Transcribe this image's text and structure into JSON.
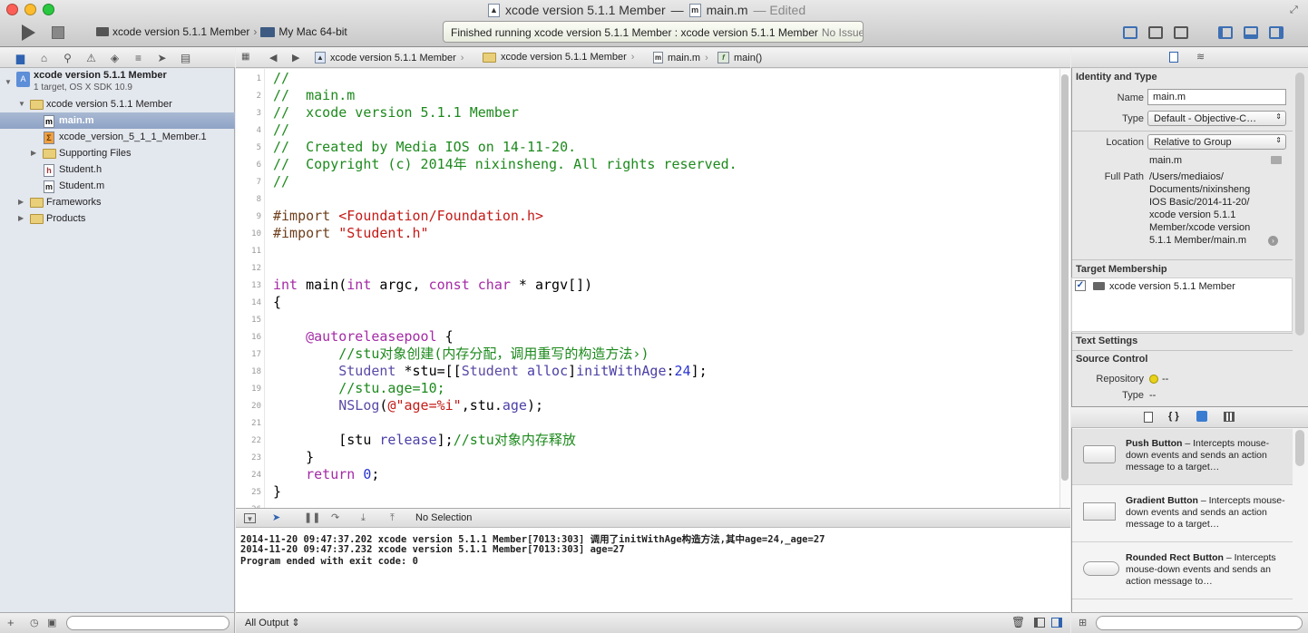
{
  "window": {
    "title_project": "xcode version 5.1.1 Member",
    "title_sep": "—",
    "title_file": "main.m",
    "title_edited": "— Edited"
  },
  "toolbar": {
    "scheme": "xcode version 5.1.1 Member",
    "destination": "My Mac 64-bit",
    "activity": "Finished running xcode version 5.1.1 Member : xcode version 5.1.1 Member",
    "issues": "No Issues"
  },
  "navigator": {
    "project_name": "xcode version 5.1.1 Member",
    "project_sub": "1 target, OS X SDK 10.9",
    "items": [
      {
        "label": "xcode version 5.1.1 Member"
      },
      {
        "label": "main.m"
      },
      {
        "label": "xcode_version_5_1_1_Member.1"
      },
      {
        "label": "Supporting Files"
      },
      {
        "label": "Student.h"
      },
      {
        "label": "Student.m"
      },
      {
        "label": "Frameworks"
      },
      {
        "label": "Products"
      }
    ]
  },
  "jumpbar": {
    "crumb1": "xcode version 5.1.1 Member",
    "crumb2": "xcode version 5.1.1 Member",
    "crumb3": "main.m",
    "crumb4": "main()"
  },
  "editor": {
    "lines": [
      "//",
      "//  main.m",
      "//  xcode version 5.1.1 Member",
      "//",
      "//  Created by Media IOS on 14-11-20.",
      "//  Copyright (c) 2014年 nixinsheng. All rights reserved.",
      "//",
      "",
      "#import <Foundation/Foundation.h>",
      "#import \"Student.h\"",
      "",
      "",
      "int main(int argc, const char * argv[])",
      "{",
      "",
      "    @autoreleasepool {",
      "        //stu对象创建(内存分配，调用重写的构造方法›)",
      "        Student *stu=[[Student alloc]initWithAge:24];",
      "        //stu.age=10;",
      "        NSLog(@\"age=%i\",stu.age);",
      "",
      "        [stu release];//stu对象内存释放",
      "    }",
      "    return 0;",
      "}",
      ""
    ]
  },
  "debug": {
    "selection": "No Selection",
    "console": [
      "2014-11-20 09:47:37.202 xcode version 5.1.1 Member[7013:303] 调用了initWithAge构造方法,其中age=24,_age=27",
      "2014-11-20 09:47:37.232 xcode version 5.1.1 Member[7013:303] age=27",
      "Program ended with exit code: 0"
    ],
    "output_filter": "All Output"
  },
  "inspector": {
    "identity_header": "Identity and Type",
    "name_label": "Name",
    "name_value": "main.m",
    "type_label": "Type",
    "type_value": "Default - Objective-C…",
    "location_label": "Location",
    "location_value": "Relative to Group",
    "location_file": "main.m",
    "fullpath_label": "Full Path",
    "fullpath_lines": [
      "/Users/mediaios/",
      "Documents/nixinsheng",
      "IOS Basic/2014-11-20/",
      "xcode version 5.1.1",
      "Member/xcode version",
      "5.1.1 Member/main.m"
    ],
    "target_header": "Target Membership",
    "target_name": "xcode version 5.1.1 Member",
    "text_settings_header": "Text Settings",
    "source_control_header": "Source Control",
    "repository_label": "Repository",
    "repository_value": "--",
    "sc_type_label": "Type",
    "sc_type_value": "--"
  },
  "library": {
    "items": [
      {
        "title": "Push Button",
        "desc": " – Intercepts mouse-down events and sends an action message to a target…"
      },
      {
        "title": "Gradient Button",
        "desc": " – Intercepts mouse-down events and sends an action message to a target…"
      },
      {
        "title": "Rounded Rect Button",
        "desc": " – Intercepts mouse-down events and sends an action message to…"
      }
    ]
  }
}
